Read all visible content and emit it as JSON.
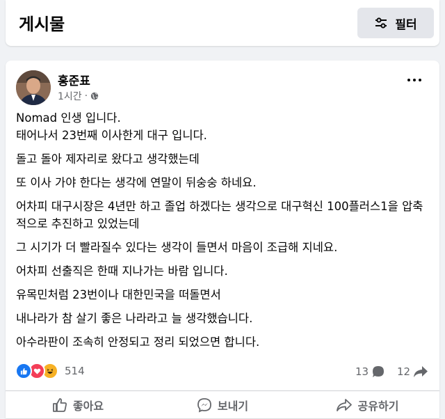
{
  "header": {
    "title": "게시물",
    "filter_label": "필터"
  },
  "post": {
    "author": "홍준표",
    "time": "1시간",
    "paragraphs": [
      "Nomad 인생 입니다.\n태어나서 23번째 이사한게 대구 입니다.",
      "돌고 돌아 제자리로 왔다고 생각했는데",
      "또 이사 가야 한다는 생각에 연말이 뒤숭숭 하네요.",
      "어차피 대구시장은 4년만 하고 졸업 하겠다는 생각으로 대구혁신 100플러스1을 압축적으로 추진하고 있었는데",
      "그 시기가 더 빨라질수 있다는 생각이 들면서 마음이 조급해 지네요.",
      "어차피 선출직은 한때 지나가는 바람 입니다.",
      "유목민처럼 23번이나 대한민국을 떠돌면서",
      "내나라가 참 살기 좋은 나라라고 늘 생각했습니다.",
      "아수라판이 조속히 안정되고 정리 되었으면 합니다."
    ],
    "reaction_count": "514",
    "comment_count": "13",
    "share_count": "12"
  },
  "actions": {
    "like": "좋아요",
    "send": "보내기",
    "share": "공유하기"
  }
}
